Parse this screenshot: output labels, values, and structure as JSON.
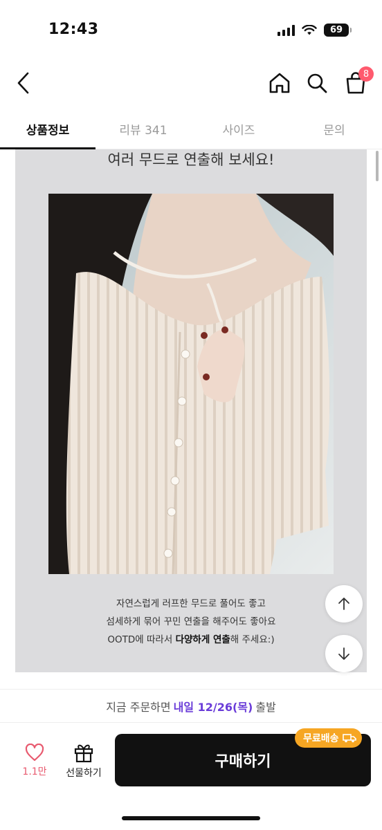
{
  "status_bar": {
    "time": "12:43",
    "battery": "69"
  },
  "header": {
    "back_icon": "chevron-left-icon",
    "home_icon": "home-icon",
    "search_icon": "search-icon",
    "cart_icon": "shopping-bag-icon",
    "cart_badge": "8"
  },
  "tabs": [
    {
      "label": "상품정보",
      "active": true
    },
    {
      "label": "리뷰 341",
      "active": false
    },
    {
      "label": "사이즈",
      "active": false
    },
    {
      "label": "문의",
      "active": false
    }
  ],
  "content": {
    "headline": "여러 무드로 연출해 보세요!",
    "desc_line1": "자연스럽게 러프한 무드로 풀어도 좋고",
    "desc_line2": "섬세하게 묶어 꾸민 연출을 해주어도 좋아요",
    "desc_line3_pre": "OOTD에 따라서 ",
    "desc_line3_bold": "다양하게 연출",
    "desc_line3_post": "해 주세요:)"
  },
  "floating": {
    "up_icon": "arrow-up-icon",
    "down_icon": "arrow-down-icon"
  },
  "delivery": {
    "prefix": "지금 주문하면",
    "highlight": "내일 12/26(목)",
    "suffix": "출발"
  },
  "bottom": {
    "like_count": "1.1만",
    "gift_label": "선물하기",
    "buy_label": "구매하기",
    "free_shipping": "무료배송"
  },
  "colors": {
    "accent_purple": "#6a3cd8",
    "like_pink": "#e85a6f",
    "badge_red": "#ff5a6e",
    "free_ship_orange": "#f6a623",
    "content_bg": "#dcdcde"
  }
}
